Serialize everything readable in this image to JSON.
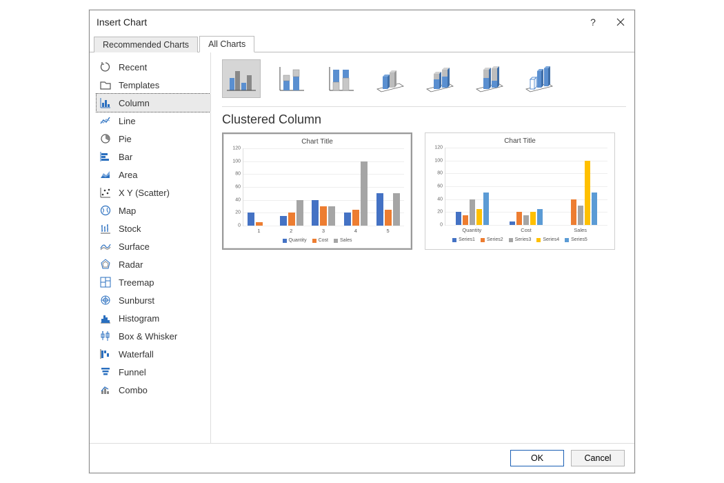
{
  "dialog": {
    "title": "Insert Chart"
  },
  "tabs": {
    "recommended": "Recommended Charts",
    "all": "All Charts"
  },
  "sidebar": {
    "items": [
      {
        "id": "recent",
        "label": "Recent"
      },
      {
        "id": "templates",
        "label": "Templates"
      },
      {
        "id": "column",
        "label": "Column"
      },
      {
        "id": "line",
        "label": "Line"
      },
      {
        "id": "pie",
        "label": "Pie"
      },
      {
        "id": "bar",
        "label": "Bar"
      },
      {
        "id": "area",
        "label": "Area"
      },
      {
        "id": "scatter",
        "label": "X Y (Scatter)"
      },
      {
        "id": "map",
        "label": "Map"
      },
      {
        "id": "stock",
        "label": "Stock"
      },
      {
        "id": "surface",
        "label": "Surface"
      },
      {
        "id": "radar",
        "label": "Radar"
      },
      {
        "id": "treemap",
        "label": "Treemap"
      },
      {
        "id": "sunburst",
        "label": "Sunburst"
      },
      {
        "id": "histogram",
        "label": "Histogram"
      },
      {
        "id": "boxwhisker",
        "label": "Box & Whisker"
      },
      {
        "id": "waterfall",
        "label": "Waterfall"
      },
      {
        "id": "funnel",
        "label": "Funnel"
      },
      {
        "id": "combo",
        "label": "Combo"
      }
    ],
    "selected": "column"
  },
  "subtype_title": "Clustered Column",
  "footer": {
    "ok": "OK",
    "cancel": "Cancel"
  },
  "colors": {
    "blue": "#4472C4",
    "orange": "#ED7D31",
    "gray": "#A5A5A5",
    "yellow": "#FFC000",
    "blue2": "#5B9BD5"
  },
  "chart_data": [
    {
      "type": "bar",
      "title": "Chart Title",
      "ylim": [
        0,
        120
      ],
      "yticks": [
        0,
        20,
        40,
        60,
        80,
        100,
        120
      ],
      "categories": [
        "1",
        "2",
        "3",
        "4",
        "5"
      ],
      "series": [
        {
          "name": "Quantity",
          "color_key": "blue",
          "values": [
            20,
            15,
            40,
            20,
            50
          ]
        },
        {
          "name": "Cost",
          "color_key": "orange",
          "values": [
            5,
            20,
            30,
            25,
            25
          ]
        },
        {
          "name": "Sales",
          "color_key": "gray",
          "values": [
            0,
            40,
            30,
            100,
            50
          ]
        }
      ]
    },
    {
      "type": "bar",
      "title": "Chart Title",
      "ylim": [
        0,
        120
      ],
      "yticks": [
        0,
        20,
        40,
        60,
        80,
        100,
        120
      ],
      "categories": [
        "Quantity",
        "Cost",
        "Sales"
      ],
      "series": [
        {
          "name": "Series1",
          "color_key": "blue",
          "values": [
            20,
            5,
            0
          ]
        },
        {
          "name": "Series2",
          "color_key": "orange",
          "values": [
            15,
            20,
            40
          ]
        },
        {
          "name": "Series3",
          "color_key": "gray",
          "values": [
            40,
            15,
            30
          ]
        },
        {
          "name": "Series4",
          "color_key": "yellow",
          "values": [
            25,
            20,
            100
          ]
        },
        {
          "name": "Series5",
          "color_key": "blue2",
          "values": [
            50,
            25,
            50
          ]
        }
      ]
    }
  ]
}
